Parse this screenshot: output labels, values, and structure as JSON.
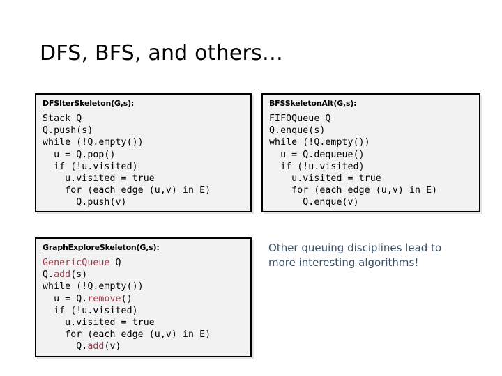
{
  "slide": {
    "title": "DFS, BFS, and others…",
    "background_color": "#ffffff"
  },
  "colors": {
    "code_text": "#000000",
    "code_highlight_red": "#9a3b48",
    "callout_blue": "#3c5167",
    "box_background": "#f2f2f2",
    "box_border": "#000000"
  },
  "boxes": {
    "dfs": {
      "header": "DFSIterSkeleton(G,s):",
      "lines": [
        "Stack Q",
        "Q.push(s)",
        "while (!Q.empty())",
        "  u = Q.pop()",
        "  if (!u.visited)",
        "    u.visited = true",
        "    for (each edge (u,v) in E)",
        "      Q.push(v)"
      ]
    },
    "bfs": {
      "header": "BFSSkeletonAlt(G,s):",
      "lines": [
        "FIFOQueue Q",
        "Q.enque(s)",
        "while (!Q.empty())",
        "  u = Q.dequeue()",
        "  if (!u.visited)",
        "    u.visited = true",
        "    for (each edge (u,v) in E)",
        "      Q.enque(v)"
      ]
    },
    "graph": {
      "header": "GraphExploreSkeleton(G,s):",
      "lines": [
        {
          "segments": [
            {
              "text": "GenericQueue",
              "highlight": true
            },
            {
              "text": " Q",
              "highlight": false
            }
          ]
        },
        {
          "segments": [
            {
              "text": "Q.",
              "highlight": false
            },
            {
              "text": "add",
              "highlight": true
            },
            {
              "text": "(s)",
              "highlight": false
            }
          ]
        },
        {
          "segments": [
            {
              "text": "while (!Q.empty())",
              "highlight": false
            }
          ]
        },
        {
          "segments": [
            {
              "text": "  u = Q.",
              "highlight": false
            },
            {
              "text": "remove",
              "highlight": true
            },
            {
              "text": "()",
              "highlight": false
            }
          ]
        },
        {
          "segments": [
            {
              "text": "  if (!u.visited)",
              "highlight": false
            }
          ]
        },
        {
          "segments": [
            {
              "text": "    u.visited = true",
              "highlight": false
            }
          ]
        },
        {
          "segments": [
            {
              "text": "    for (each edge (u,v) in E)",
              "highlight": false
            }
          ]
        },
        {
          "segments": [
            {
              "text": "      Q.",
              "highlight": false
            },
            {
              "text": "add",
              "highlight": true
            },
            {
              "text": "(v)",
              "highlight": false
            }
          ]
        }
      ]
    }
  },
  "callout": {
    "text": "Other queuing disciplines lead to more interesting algorithms!"
  }
}
